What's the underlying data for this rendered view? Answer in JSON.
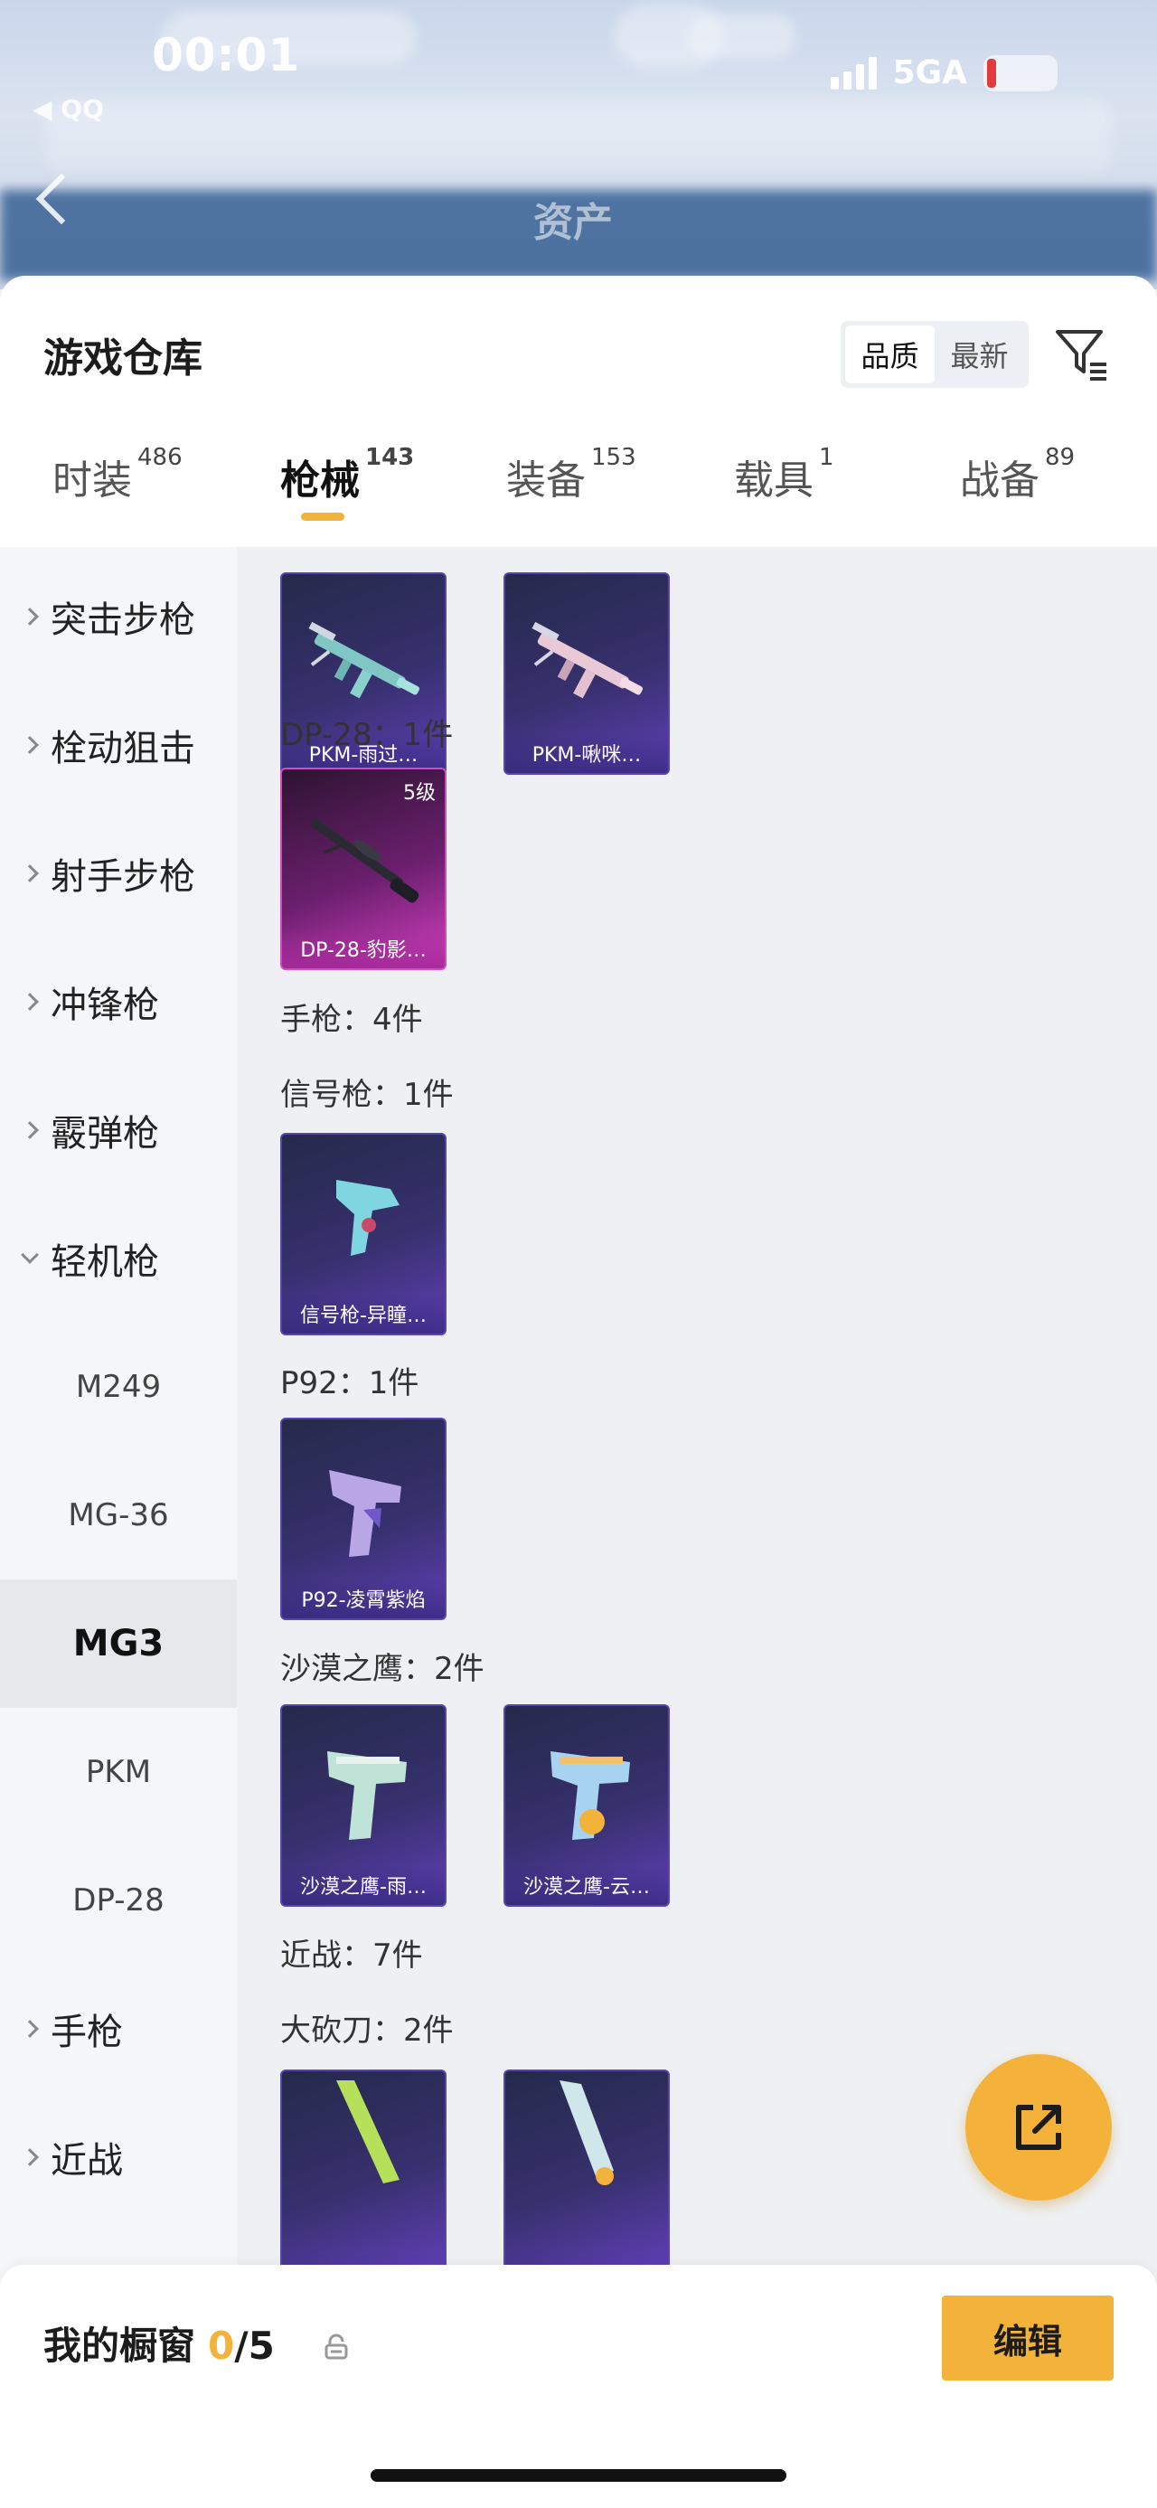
{
  "status_bar": {
    "time": "00:01",
    "network": "5GA",
    "back_app": "◀ QQ"
  },
  "background": {
    "page_title": "资产"
  },
  "sheet": {
    "title": "游戏仓库",
    "sort": {
      "quality": "品质",
      "newest": "最新"
    }
  },
  "tabs": [
    {
      "label": "时装",
      "count": "486"
    },
    {
      "label": "枪械",
      "count": "143"
    },
    {
      "label": "装备",
      "count": "153"
    },
    {
      "label": "载具",
      "count": "1"
    },
    {
      "label": "战备",
      "count": "89"
    }
  ],
  "sidebar": {
    "categories": [
      {
        "label": "突击步枪"
      },
      {
        "label": "栓动狙击"
      },
      {
        "label": "射手步枪"
      },
      {
        "label": "冲锋枪"
      },
      {
        "label": "霰弹枪"
      },
      {
        "label": "轻机枪"
      },
      {
        "label": "手枪"
      },
      {
        "label": "近战"
      }
    ],
    "subitems": [
      {
        "label": "M249"
      },
      {
        "label": "MG-36"
      },
      {
        "label": "MG3"
      },
      {
        "label": "PKM"
      },
      {
        "label": "DP-28"
      }
    ]
  },
  "content": {
    "items": [
      {
        "name": "PKM-雨过…"
      },
      {
        "name": "PKM-啾咪…"
      },
      {
        "name": "DP-28-豹影…",
        "level": "5级"
      },
      {
        "name": "信号枪-异瞳…"
      },
      {
        "name": "P92-凌霄紫焰"
      },
      {
        "name": "沙漠之鹰-雨…"
      },
      {
        "name": "沙漠之鹰-云…"
      }
    ],
    "groups": [
      {
        "label": "DP-28：1件"
      },
      {
        "label": "手枪：4件"
      },
      {
        "label": "信号枪：1件"
      },
      {
        "label": "P92：1件"
      },
      {
        "label": "沙漠之鹰：2件"
      },
      {
        "label": "近战：7件"
      },
      {
        "label": "大砍刀：2件"
      }
    ]
  },
  "bottom_bar": {
    "showcase_label": "我的橱窗",
    "showcase_current": "0",
    "showcase_total": "/5",
    "edit_label": "编辑"
  },
  "colors": {
    "accent": "#f3b23a",
    "card_purple": "#37306e",
    "card_pink": "#d43fc2"
  }
}
